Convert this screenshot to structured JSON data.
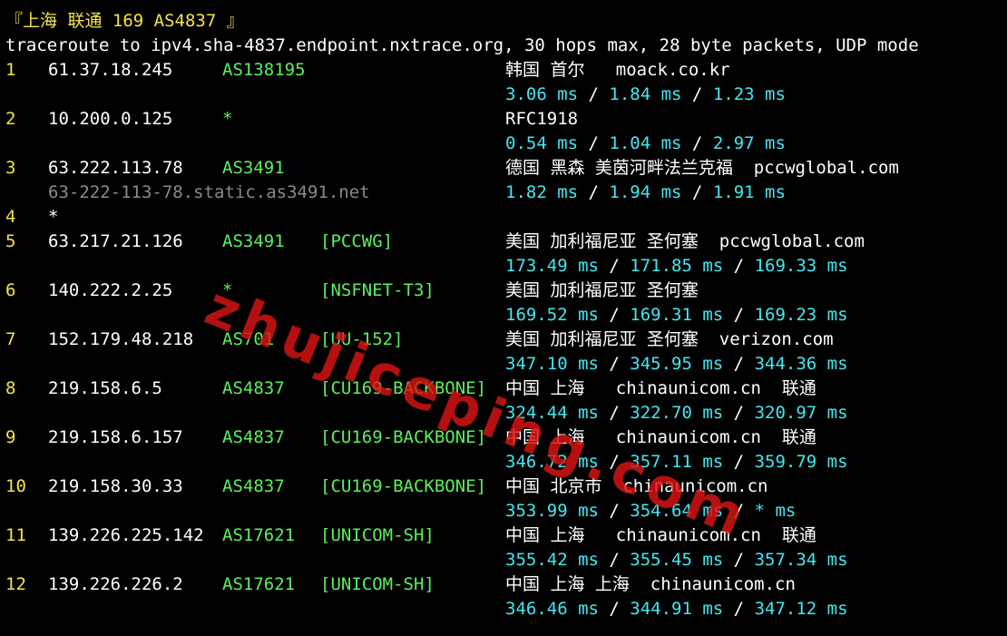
{
  "header": {
    "title": "『上海 联通 169 AS4837 』",
    "command": "traceroute to ipv4.sha-4837.endpoint.nxtrace.org, 30 hops max, 28 byte packets, UDP mode"
  },
  "hops": [
    {
      "hop": "1",
      "ip": "61.37.18.245",
      "asn": "AS138195",
      "tag": "",
      "geo": "韩国 首尔",
      "host": "moack.co.kr",
      "isp": "",
      "rdns": "",
      "rtt": [
        "3.06 ms",
        "1.84 ms",
        "1.23 ms"
      ]
    },
    {
      "hop": "2",
      "ip": "10.200.0.125",
      "asn": "*",
      "tag": "",
      "geo": "RFC1918",
      "host": "",
      "isp": "",
      "rdns": "",
      "rtt": [
        "0.54 ms",
        "1.04 ms",
        "2.97 ms"
      ]
    },
    {
      "hop": "3",
      "ip": "63.222.113.78",
      "asn": "AS3491",
      "tag": "",
      "geo": "德国 黑森 美茵河畔法兰克福",
      "host": "pccwglobal.com",
      "isp": "",
      "rdns": "63-222-113-78.static.as3491.net",
      "rtt": [
        "1.82 ms",
        "1.94 ms",
        "1.91 ms"
      ]
    },
    {
      "hop": "4",
      "ip": "*",
      "asn": "",
      "tag": "",
      "geo": "",
      "host": "",
      "isp": "",
      "rdns": "",
      "rtt": []
    },
    {
      "hop": "5",
      "ip": "63.217.21.126",
      "asn": "AS3491",
      "tag": "[PCCWG]",
      "geo": "美国 加利福尼亚 圣何塞",
      "host": "pccwglobal.com",
      "isp": "",
      "rdns": "",
      "rtt": [
        "173.49 ms",
        "171.85 ms",
        "169.33 ms"
      ]
    },
    {
      "hop": "6",
      "ip": "140.222.2.25",
      "asn": "*",
      "tag": "[NSFNET-T3]",
      "geo": "美国 加利福尼亚 圣何塞",
      "host": "",
      "isp": "",
      "rdns": "",
      "rtt": [
        "169.52 ms",
        "169.31 ms",
        "169.23 ms"
      ]
    },
    {
      "hop": "7",
      "ip": "152.179.48.218",
      "asn": "AS701",
      "tag": "[UU-152]",
      "geo": "美国 加利福尼亚 圣何塞",
      "host": "verizon.com",
      "isp": "",
      "rdns": "",
      "rtt": [
        "347.10 ms",
        "345.95 ms",
        "344.36 ms"
      ]
    },
    {
      "hop": "8",
      "ip": "219.158.6.5",
      "asn": "AS4837",
      "tag": "[CU169-BACKBONE]",
      "geo": "中国 上海",
      "host": "chinaunicom.cn",
      "isp": "联通",
      "rdns": "",
      "rtt": [
        "324.44 ms",
        "322.70 ms",
        "320.97 ms"
      ]
    },
    {
      "hop": "9",
      "ip": "219.158.6.157",
      "asn": "AS4837",
      "tag": "[CU169-BACKBONE]",
      "geo": "中国 上海",
      "host": "chinaunicom.cn",
      "isp": "联通",
      "rdns": "",
      "rtt": [
        "346.72 ms",
        "357.11 ms",
        "359.79 ms"
      ]
    },
    {
      "hop": "10",
      "ip": "219.158.30.33",
      "asn": "AS4837",
      "tag": "[CU169-BACKBONE]",
      "geo": "中国 北京市",
      "host": "chinaunicom.cn",
      "isp": "",
      "rdns": "",
      "rtt": [
        "353.99 ms",
        "354.64 ms",
        "* ms"
      ]
    },
    {
      "hop": "11",
      "ip": "139.226.225.142",
      "asn": "AS17621",
      "tag": "[UNICOM-SH]",
      "geo": "中国 上海",
      "host": "chinaunicom.cn",
      "isp": "联通",
      "rdns": "",
      "rtt": [
        "355.42 ms",
        "355.45 ms",
        "357.34 ms"
      ]
    },
    {
      "hop": "12",
      "ip": "139.226.226.2",
      "asn": "AS17621",
      "tag": "[UNICOM-SH]",
      "geo": "中国 上海 上海",
      "host": "chinaunicom.cn",
      "isp": "",
      "rdns": "",
      "rtt": [
        "346.46 ms",
        "344.91 ms",
        "347.12 ms"
      ]
    }
  ],
  "separator": " / ",
  "watermark": "zhujiceping.com",
  "colors": {
    "background": "#000000",
    "title": "#f4e34a",
    "hop_number": "#f4e34a",
    "asn": "#5bf05b",
    "rtt": "#42e8f0",
    "rdns": "#8a8a8a",
    "watermark": "#dc1414"
  }
}
